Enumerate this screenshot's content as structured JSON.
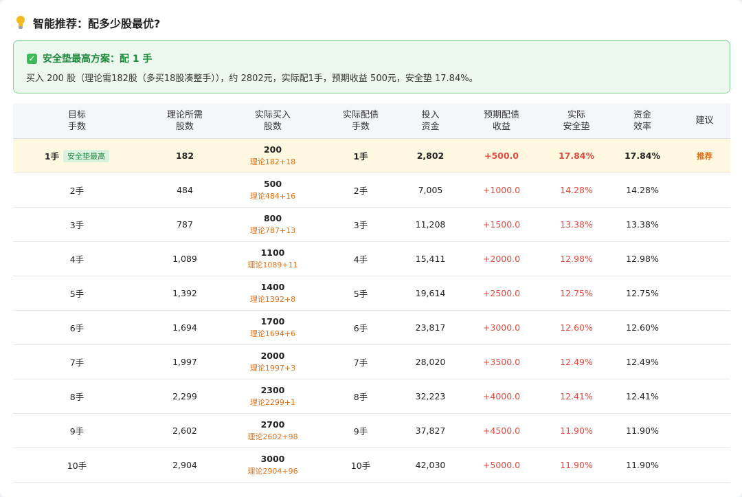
{
  "header": {
    "title": "智能推荐：配多少股最优?"
  },
  "recommendation": {
    "title": "安全垫最高方案：配 1 手",
    "description": "买入 200 股（理论需182股（多买18股凑整手）），约 2802元，实际配1手，预期收益 500元，安全垫 17.84%。"
  },
  "table": {
    "columns": [
      [
        "目标",
        "手数"
      ],
      [
        "理论所需",
        "股数"
      ],
      [
        "实际买入",
        "股数"
      ],
      [
        "实际配债",
        "手数"
      ],
      [
        "投入",
        "资金"
      ],
      [
        "预期配债",
        "收益"
      ],
      [
        "实际",
        "安全垫"
      ],
      [
        "资金",
        "效率"
      ],
      [
        "建议",
        ""
      ]
    ],
    "rows": [
      {
        "target": "1手",
        "badge": "安全垫最高",
        "theory": "182",
        "actual": "200",
        "actual_note": "理论182+18",
        "bonds": "1手",
        "capital": "2,802",
        "income": "+500.0",
        "safety": "17.84%",
        "efficiency": "17.84%",
        "advice": "推荐"
      },
      {
        "target": "2手",
        "badge": "",
        "theory": "484",
        "actual": "500",
        "actual_note": "理论484+16",
        "bonds": "2手",
        "capital": "7,005",
        "income": "+1000.0",
        "safety": "14.28%",
        "efficiency": "14.28%",
        "advice": ""
      },
      {
        "target": "3手",
        "badge": "",
        "theory": "787",
        "actual": "800",
        "actual_note": "理论787+13",
        "bonds": "3手",
        "capital": "11,208",
        "income": "+1500.0",
        "safety": "13.38%",
        "efficiency": "13.38%",
        "advice": ""
      },
      {
        "target": "4手",
        "badge": "",
        "theory": "1,089",
        "actual": "1100",
        "actual_note": "理论1089+11",
        "bonds": "4手",
        "capital": "15,411",
        "income": "+2000.0",
        "safety": "12.98%",
        "efficiency": "12.98%",
        "advice": ""
      },
      {
        "target": "5手",
        "badge": "",
        "theory": "1,392",
        "actual": "1400",
        "actual_note": "理论1392+8",
        "bonds": "5手",
        "capital": "19,614",
        "income": "+2500.0",
        "safety": "12.75%",
        "efficiency": "12.75%",
        "advice": ""
      },
      {
        "target": "6手",
        "badge": "",
        "theory": "1,694",
        "actual": "1700",
        "actual_note": "理论1694+6",
        "bonds": "6手",
        "capital": "23,817",
        "income": "+3000.0",
        "safety": "12.60%",
        "efficiency": "12.60%",
        "advice": ""
      },
      {
        "target": "7手",
        "badge": "",
        "theory": "1,997",
        "actual": "2000",
        "actual_note": "理论1997+3",
        "bonds": "7手",
        "capital": "28,020",
        "income": "+3500.0",
        "safety": "12.49%",
        "efficiency": "12.49%",
        "advice": ""
      },
      {
        "target": "8手",
        "badge": "",
        "theory": "2,299",
        "actual": "2300",
        "actual_note": "理论2299+1",
        "bonds": "8手",
        "capital": "32,223",
        "income": "+4000.0",
        "safety": "12.41%",
        "efficiency": "12.41%",
        "advice": ""
      },
      {
        "target": "9手",
        "badge": "",
        "theory": "2,602",
        "actual": "2700",
        "actual_note": "理论2602+98",
        "bonds": "9手",
        "capital": "37,827",
        "income": "+4500.0",
        "safety": "11.90%",
        "efficiency": "11.90%",
        "advice": ""
      },
      {
        "target": "10手",
        "badge": "",
        "theory": "2,904",
        "actual": "3000",
        "actual_note": "理论2904+96",
        "bonds": "10手",
        "capital": "42,030",
        "income": "+5000.0",
        "safety": "11.90%",
        "efficiency": "11.90%",
        "advice": ""
      }
    ]
  }
}
